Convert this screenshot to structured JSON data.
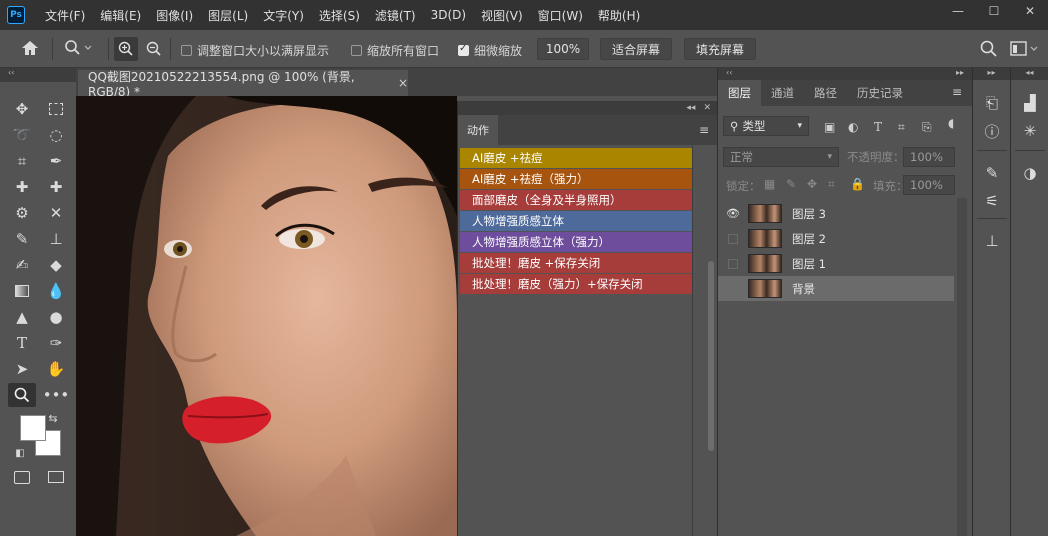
{
  "app": {
    "logo": "Ps"
  },
  "menu": [
    "文件(F)",
    "编辑(E)",
    "图像(I)",
    "图层(L)",
    "文字(Y)",
    "选择(S)",
    "滤镜(T)",
    "3D(D)",
    "视图(V)",
    "窗口(W)",
    "帮助(H)"
  ],
  "window_controls": {
    "minimize": "—",
    "maximize": "☐",
    "close": "✕"
  },
  "options": {
    "resize_windows_label": "调整窗口大小以满屏显示",
    "zoom_all_label": "缩放所有窗口",
    "scrubby_zoom_label": "细微缩放",
    "zoom_value": "100%",
    "fit_screen_label": "适合屏幕",
    "fill_screen_label": "填充屏幕"
  },
  "document": {
    "tab_title": "QQ截图20210522213554.png @ 100% (背景, RGB/8) *",
    "close_glyph": "×"
  },
  "actions_panel": {
    "tab": "动作",
    "items": [
      {
        "label": "AI磨皮 +祛痘",
        "color": "#a98500"
      },
      {
        "label": "AI磨皮 +祛痘（强力）",
        "color": "#a7540f"
      },
      {
        "label": "面部磨皮（全身及半身照用）",
        "color": "#a63d3b"
      },
      {
        "label": "人物增强质感立体",
        "color": "#4d6a9a"
      },
      {
        "label": "人物增强质感立体（强力）",
        "color": "#6d4d9c"
      },
      {
        "label": "批处理！磨皮 +保存关闭",
        "color": "#a63d3b"
      },
      {
        "label": "批处理！磨皮（强力）+保存关闭",
        "color": "#a63d3b"
      }
    ]
  },
  "layers_panel": {
    "tabs": [
      "图层",
      "通道",
      "路径",
      "历史记录"
    ],
    "filter_kind": "类型",
    "blend_mode": "正常",
    "opacity_label": "不透明度：",
    "opacity_value": "100%",
    "lock_label": "锁定：",
    "fill_label": "填充：",
    "fill_value": "100%",
    "layers": [
      {
        "name": "图层 3",
        "visible": true,
        "selected": false
      },
      {
        "name": "图层 2",
        "visible": false,
        "selected": false
      },
      {
        "name": "图层 1",
        "visible": false,
        "selected": false
      },
      {
        "name": "背景",
        "visible": false,
        "selected": true
      }
    ]
  },
  "icons": {
    "home": "home-icon",
    "zoom": "zoom-icon",
    "search": "search-icon",
    "move": "move-tool-icon",
    "marquee": "marquee-tool-icon",
    "lasso": "lasso-tool-icon",
    "eye": "eye-icon"
  }
}
